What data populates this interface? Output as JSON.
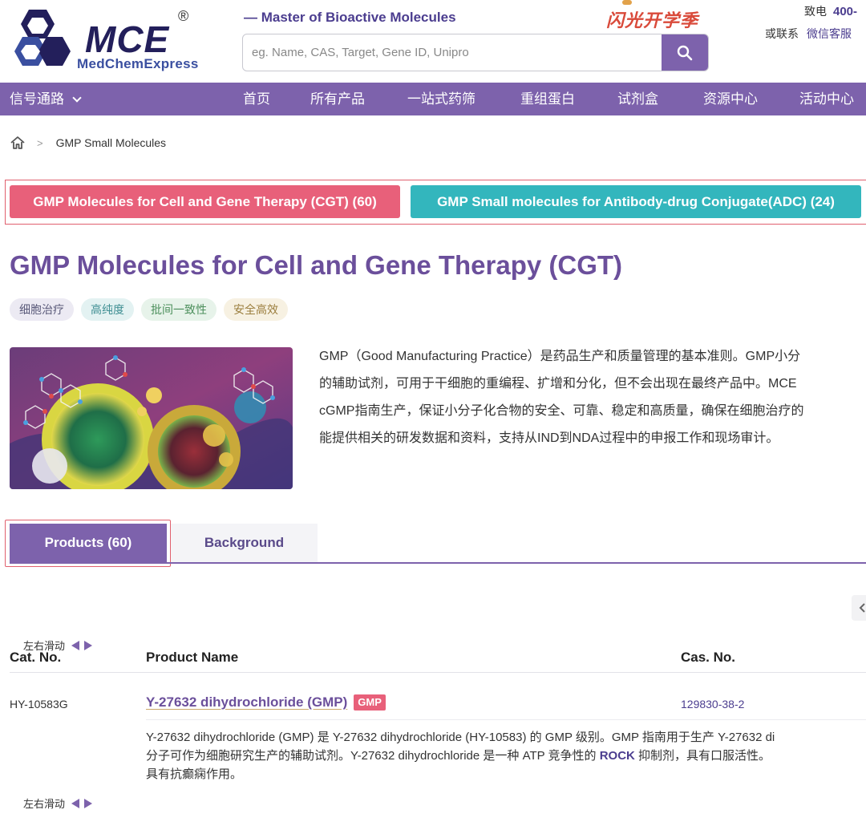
{
  "header": {
    "logo_mce": "MCE",
    "logo_sub": "MedChemExpress",
    "logo_reg": "®",
    "tagline": "— Master of Bioactive Molecules",
    "search_placeholder": "eg. Name, CAS, Target, Gene ID, Unipro",
    "promo": "闪光开学季",
    "contact_label": "致电",
    "contact_phone": "400-",
    "contact_or": "或联系",
    "contact_wechat": "微信客服"
  },
  "nav": {
    "signal": "信号通路",
    "items": [
      "首页",
      "所有产品",
      "一站式药筛",
      "重组蛋白",
      "试剂盒",
      "资源中心",
      "活动中心"
    ]
  },
  "breadcrumb": {
    "current": "GMP Small Molecules"
  },
  "categories": {
    "cgt": "GMP Molecules for Cell and Gene Therapy (CGT) (60)",
    "adc": "GMP Small molecules for Antibody-drug Conjugate(ADC) (24)"
  },
  "page_title": "GMP Molecules for Cell and Gene Therapy (CGT)",
  "tags": [
    "细胞治疗",
    "高纯度",
    "批间一致性",
    "安全高效"
  ],
  "description": [
    "GMP（Good Manufacturing Practice）是药品生产和质量管理的基本准则。GMP小分",
    "的辅助试剂，可用于干细胞的重编程、扩增和分化，但不会出现在最终产品中。MCE",
    "cGMP指南生产，保证小分子化合物的安全、可靠、稳定和高质量，确保在细胞治疗的",
    "能提供相关的研发数据和资料，支持从IND到NDA过程中的申报工作和现场审计。"
  ],
  "tabs": {
    "products": "Products (60)",
    "background": "Background"
  },
  "slide_hint": "左右滑动",
  "table": {
    "headers": [
      "Cat. No.",
      "Product Name",
      "Cas. No."
    ],
    "rows": [
      {
        "cat_no": "HY-10583G",
        "name": "Y-27632 dihydrochloride (GMP)",
        "badge": "GMP",
        "cas": "129830-38-2",
        "desc_line1": "Y-27632 dihydrochloride (GMP) 是 Y-27632 dihydrochloride (HY-10583) 的 GMP 级别。GMP 指南用于生产 Y-27632 di",
        "desc_line2_a": "分子可作为细胞研究生产的辅助试剂。Y-27632 dihydrochloride 是一种 ATP 竞争性的 ",
        "desc_line2_rock": "ROCK",
        "desc_line2_b": " 抑制剂，具有口服活性。",
        "desc_line3": "具有抗癫痫作用。"
      }
    ]
  },
  "colors": {
    "brand_purple": "#7d62ac",
    "title_purple": "#6b4f9b",
    "cgt_pink": "#e8607a",
    "adc_teal": "#33b6bd"
  }
}
